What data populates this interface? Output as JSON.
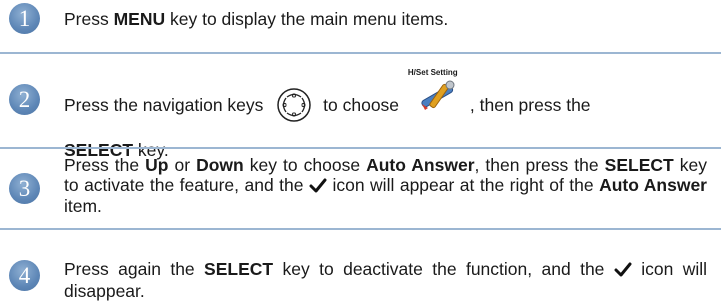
{
  "steps": [
    {
      "number": "1",
      "parts": [
        "Press ",
        "MENU",
        " key to display the main menu items."
      ]
    },
    {
      "number": "2",
      "parts": [
        "Press the navigation keys ",
        " to choose ",
        ", then press the ",
        "SELECT",
        " key."
      ],
      "icon_label": "H/Set Setting"
    },
    {
      "number": "3",
      "parts": [
        "Press the ",
        "Up",
        " or ",
        "Down",
        " key to choose ",
        "Auto Answer",
        ", then press the ",
        "SELECT",
        " key to activate the feature, and the ",
        " icon will appear at the right of the ",
        "Auto Answer",
        " item."
      ]
    },
    {
      "number": "4",
      "parts": [
        "Press again the ",
        "SELECT",
        " key to deactivate the function, and the ",
        " icon will disappear."
      ]
    }
  ],
  "icons": {
    "navigation_keys": "navigation-keys-icon",
    "handset_setting": "handset-setting-icon",
    "checkmark": "checkmark-icon"
  },
  "colors": {
    "number_badge": "#5d86b6",
    "divider": "#9cb6d2",
    "text": "#1a1a1a"
  }
}
